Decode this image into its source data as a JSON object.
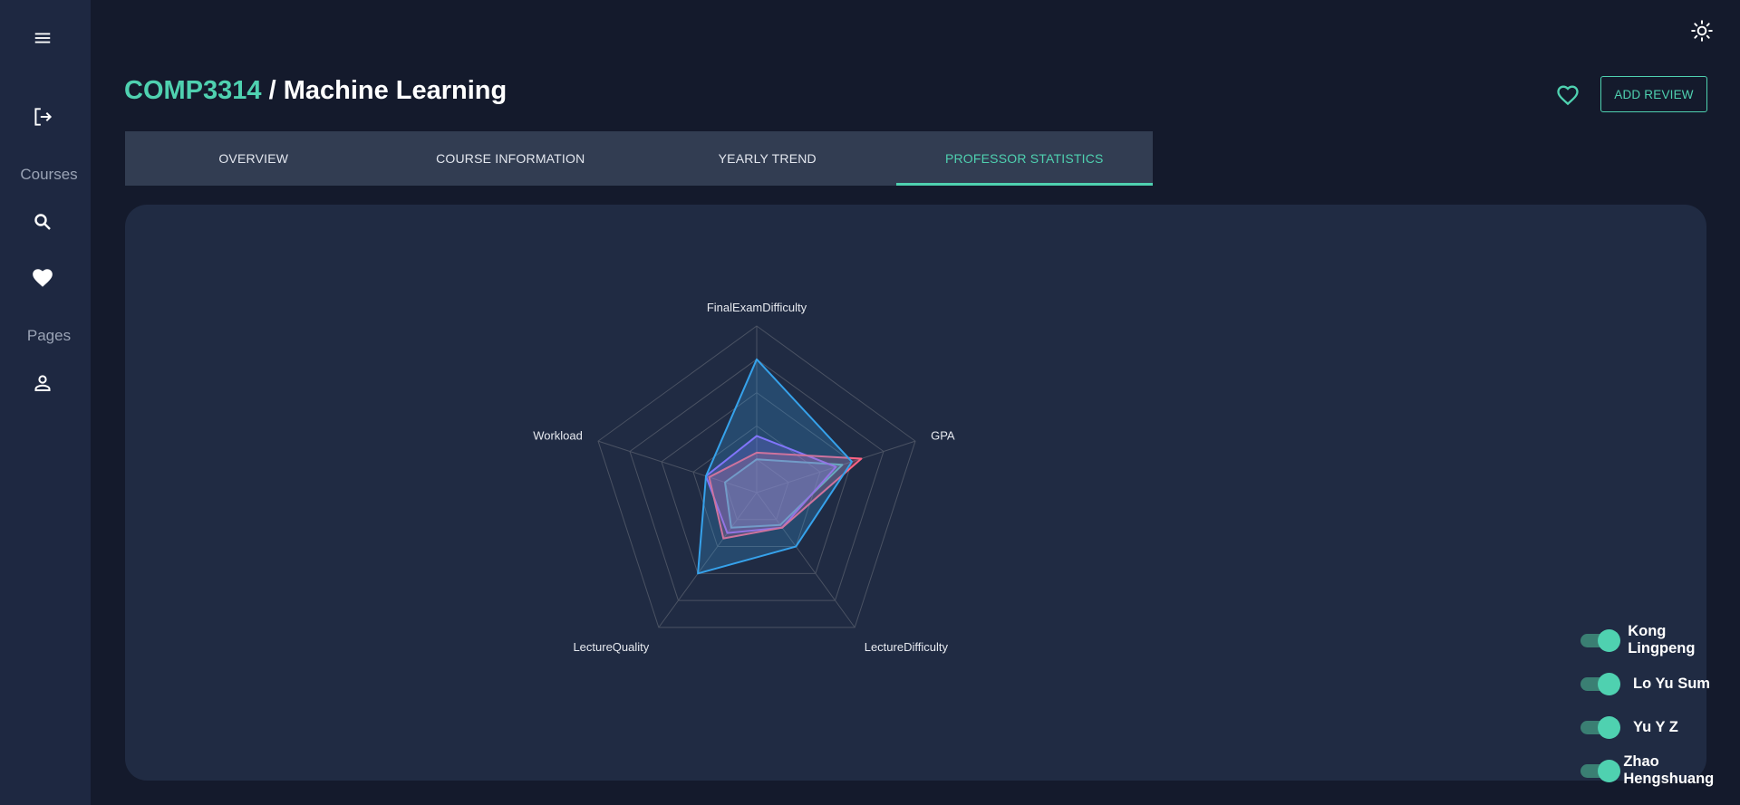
{
  "sidebar": {
    "courses_label": "Courses",
    "pages_label": "Pages",
    "icons": [
      "menu-icon",
      "logout-icon",
      "search-icon",
      "heart-icon",
      "person-icon"
    ]
  },
  "header": {
    "course_code": "COMP3314",
    "separator": " / ",
    "course_name": "Machine Learning",
    "add_review_label": "ADD REVIEW"
  },
  "tabs": [
    {
      "label": "OVERVIEW",
      "active": false
    },
    {
      "label": "COURSE INFORMATION",
      "active": false
    },
    {
      "label": "YEARLY TREND",
      "active": false
    },
    {
      "label": "PROFESSOR STATISTICS",
      "active": true
    }
  ],
  "colors": {
    "accent": "#4fd1b0",
    "series": [
      "#36a2eb",
      "#ff6384",
      "#9966ff",
      "#4bc0c0"
    ]
  },
  "chart_data": {
    "type": "radar",
    "axes": [
      "FinalExamDifficulty",
      "GPA",
      "LectureDifficulty",
      "LectureQuality",
      "Workload"
    ],
    "range": [
      0,
      5
    ],
    "rings": 5,
    "series": [
      {
        "name": "Kong Lingpeng",
        "values": [
          4,
          3,
          2,
          3,
          1.6
        ]
      },
      {
        "name": "Lo Yu Sum",
        "values": [
          1.2,
          3.3,
          1.3,
          1.7,
          1.5
        ]
      },
      {
        "name": "Yu Y Z",
        "values": [
          1.7,
          2.5,
          1.3,
          1.5,
          1.6
        ]
      },
      {
        "name": "Zhao Hengshuang",
        "values": [
          1,
          2.7,
          1.2,
          1.3,
          1
        ]
      }
    ]
  },
  "legend": [
    {
      "name": "Kong Lingpeng",
      "enabled": true
    },
    {
      "name": "Lo Yu Sum",
      "enabled": true
    },
    {
      "name": "Yu Y Z",
      "enabled": true
    },
    {
      "name": "Zhao Hengshuang",
      "enabled": true
    }
  ]
}
